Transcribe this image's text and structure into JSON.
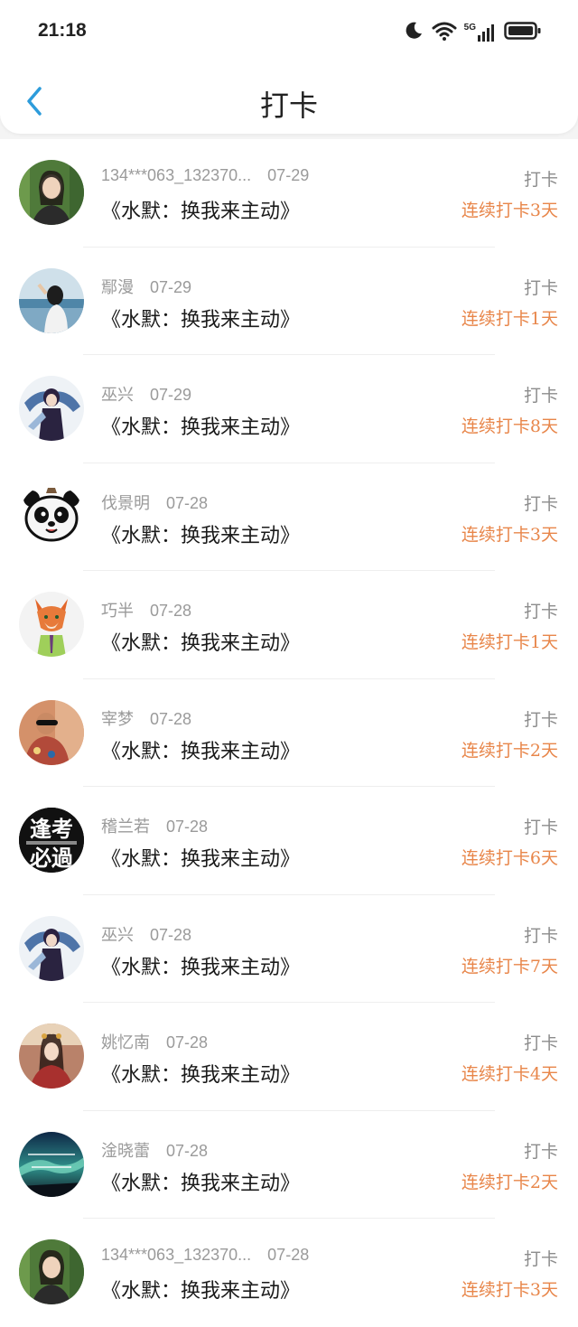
{
  "status_bar": {
    "time": "21:18",
    "network_label": "5G",
    "icons": [
      "moon-icon",
      "wifi-icon",
      "signal-5g-icon",
      "battery-icon"
    ]
  },
  "header": {
    "title": "打卡",
    "back_icon": "chevron-left-icon"
  },
  "colors": {
    "accent": "#2d9cdb",
    "streak": "#e8864a",
    "muted": "#9a9a9a"
  },
  "records": [
    {
      "name": "134***063_132370...",
      "date": "07-29",
      "book": "《水默：换我来主动》",
      "type": "打卡",
      "streak": "连续打卡3天"
    },
    {
      "name": "鄢漫",
      "date": "07-29",
      "book": "《水默：换我来主动》",
      "type": "打卡",
      "streak": "连续打卡1天"
    },
    {
      "name": "巫兴",
      "date": "07-29",
      "book": "《水默：换我来主动》",
      "type": "打卡",
      "streak": "连续打卡8天"
    },
    {
      "name": "伐景明",
      "date": "07-28",
      "book": "《水默：换我来主动》",
      "type": "打卡",
      "streak": "连续打卡3天"
    },
    {
      "name": "巧半",
      "date": "07-28",
      "book": "《水默：换我来主动》",
      "type": "打卡",
      "streak": "连续打卡1天"
    },
    {
      "name": "宰梦",
      "date": "07-28",
      "book": "《水默：换我来主动》",
      "type": "打卡",
      "streak": "连续打卡2天"
    },
    {
      "name": "稽兰若",
      "date": "07-28",
      "book": "《水默：换我来主动》",
      "type": "打卡",
      "streak": "连续打卡6天",
      "avatar_text": [
        "逢考",
        "必過"
      ]
    },
    {
      "name": "巫兴",
      "date": "07-28",
      "book": "《水默：换我来主动》",
      "type": "打卡",
      "streak": "连续打卡7天"
    },
    {
      "name": "姚忆南",
      "date": "07-28",
      "book": "《水默：换我来主动》",
      "type": "打卡",
      "streak": "连续打卡4天"
    },
    {
      "name": "淦晓蕾",
      "date": "07-28",
      "book": "《水默：换我来主动》",
      "type": "打卡",
      "streak": "连续打卡2天"
    },
    {
      "name": "134***063_132370...",
      "date": "07-28",
      "book": "《水默：换我来主动》",
      "type": "打卡",
      "streak": "连续打卡3天"
    }
  ]
}
